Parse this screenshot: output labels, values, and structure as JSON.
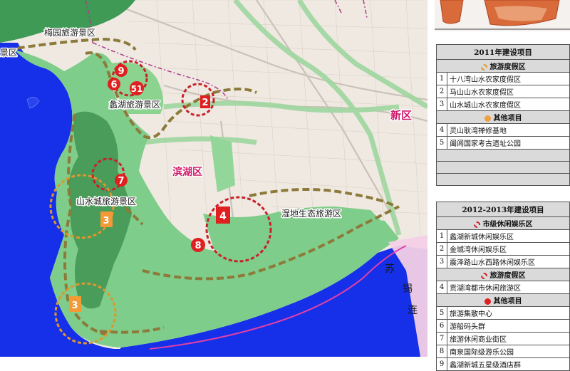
{
  "map": {
    "labels": {
      "meiyuan": "梅园旅游景区",
      "lihu": "蠡湖旅游景区",
      "shanshuicheng": "山水城旅游景区",
      "binhu": "滨湖区",
      "xinqu": "新区",
      "shidi": "湿地生态旅游区",
      "xi": "锡",
      "lian": "连",
      "su": "苏",
      "edge_jingqu": "景区"
    },
    "markers": {
      "m9": "9",
      "m6": "6",
      "m51": "51",
      "m2": "2",
      "m7": "7",
      "m3a": "3",
      "m3b": "3",
      "m4": "4",
      "m8": "8"
    },
    "colors": {
      "lake": "#1530e8",
      "green": "#7fcd8a",
      "urban": "#efe9e1",
      "tourism_boundary": "#8c7a3a",
      "red_marker": "#e02020",
      "orange_marker": "#f39a36",
      "district_label": "#d01a6a"
    }
  },
  "legend": {
    "section1": {
      "title": "2011年建设项目",
      "cat1": "旅游度假区",
      "items1": [
        {
          "n": "1",
          "text": "十八湾山水农家度假区"
        },
        {
          "n": "2",
          "text": "马山山水农家度假区"
        },
        {
          "n": "3",
          "text": "山水城山水农家度假区"
        }
      ],
      "cat2": "其他项目",
      "items2": [
        {
          "n": "4",
          "text": "灵山耿湾禅修基地"
        },
        {
          "n": "5",
          "text": "阖闾国家考古遗址公园"
        }
      ]
    },
    "section2": {
      "title": "2012-2013年建设项目",
      "cat1": "市级休闲娱乐区",
      "items1": [
        {
          "n": "1",
          "text": "蠡湖新城休闲娱乐区"
        },
        {
          "n": "2",
          "text": "金城湾休闲娱乐区"
        },
        {
          "n": "3",
          "text": "震泽路山水西路休闲娱乐区"
        }
      ],
      "cat2": "旅游度假区",
      "items2": [
        {
          "n": "4",
          "text": "贡湖湾都市休闲旅游区"
        }
      ],
      "cat3": "其他项目",
      "items3": [
        {
          "n": "5",
          "text": "旅游集散中心"
        },
        {
          "n": "6",
          "text": "游船码头群"
        },
        {
          "n": "7",
          "text": "旅游休闲商业街区"
        },
        {
          "n": "8",
          "text": "南泉国际级游乐公园"
        },
        {
          "n": "9",
          "text": "蠡湖新城五星级酒店群"
        }
      ]
    }
  }
}
